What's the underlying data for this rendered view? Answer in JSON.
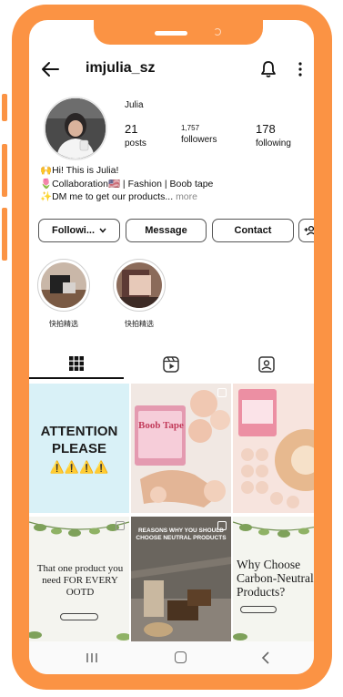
{
  "header": {
    "username": "imjulia_sz"
  },
  "profile": {
    "display_name": "Julia",
    "posts_count": "21",
    "posts_label": "posts",
    "followers_count": "1,757",
    "followers_label": "followers",
    "following_count": "178",
    "following_label": "following",
    "bio": [
      "🙌Hi! This is Julia!",
      "🌷Collaboration🇺🇸 | Fashion | Boob tape",
      "✨DM me to get our products...",
      "more"
    ]
  },
  "actions": {
    "following_label": "Followi...",
    "message_label": "Message",
    "contact_label": "Contact"
  },
  "highlights": [
    {
      "label": "快拍精选"
    },
    {
      "label": "快拍精选"
    }
  ],
  "posts": {
    "p1_heading": "ATTENTION PLEASE",
    "p1_emoji": "⚠️⚠️⚠️⚠️",
    "p2_brand": "Boob Tape",
    "p4_heading": "That one product you need FOR EVERY OOTD",
    "p5_caption": "REASONS WHY YOU SHOULD CHOOSE NEUTRAL PRODUCTS",
    "p6_heading": "Why Choose Carbon-Neutral Products?"
  },
  "colors": {
    "frame": "#fb9344",
    "ink": "#111111"
  }
}
